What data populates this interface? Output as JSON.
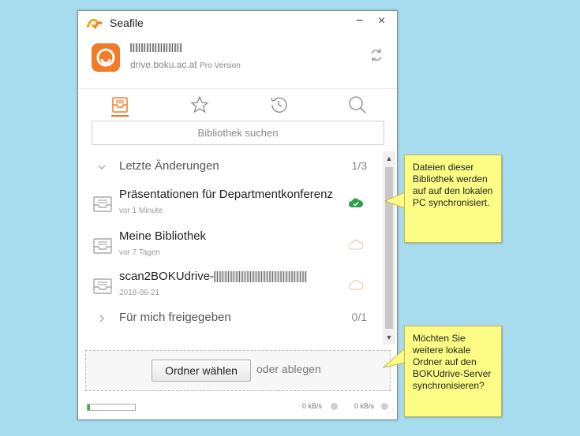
{
  "window": {
    "title": "Seafile",
    "minimize_label": "−",
    "close_label": "×"
  },
  "account": {
    "name": "(unleserlich)",
    "server": "drive.boku.ac.at",
    "edition": "Pro Version"
  },
  "search": {
    "placeholder": "Bibliothek suchen"
  },
  "sections": [
    {
      "label": "Letzte Änderungen",
      "count": "1/3"
    },
    {
      "label": "Für mich freigegeben",
      "count": "0/1"
    }
  ],
  "repos": [
    {
      "name": "Präsentationen für Departmentkonferenz",
      "time": "vor 1 Minute",
      "status": "synced"
    },
    {
      "name": "Meine Bibliothek",
      "time": "vor 7 Tagen",
      "status": "cloud"
    },
    {
      "name": "scan2BOKUdrive-",
      "time": "2018-06-21",
      "status": "cloud"
    }
  ],
  "dropzone": {
    "button_label": "Ordner wählen",
    "text": "oder ablegen"
  },
  "status": {
    "upload_rate": "0 kB/s",
    "download_rate": "0 kB/s",
    "progress_fraction": 0.05
  },
  "callouts": [
    {
      "text": "Dateien dieser Bibliothek werden auf auf den lokalen PC synchronisiert."
    },
    {
      "text": "Möchten Sie weitere lokale Ordner auf den BOKUdrive-Server synchronisieren?"
    }
  ],
  "colors": {
    "accent": "#f27b2a",
    "synced": "#2e9e4a",
    "callout": "#fdfd86"
  }
}
